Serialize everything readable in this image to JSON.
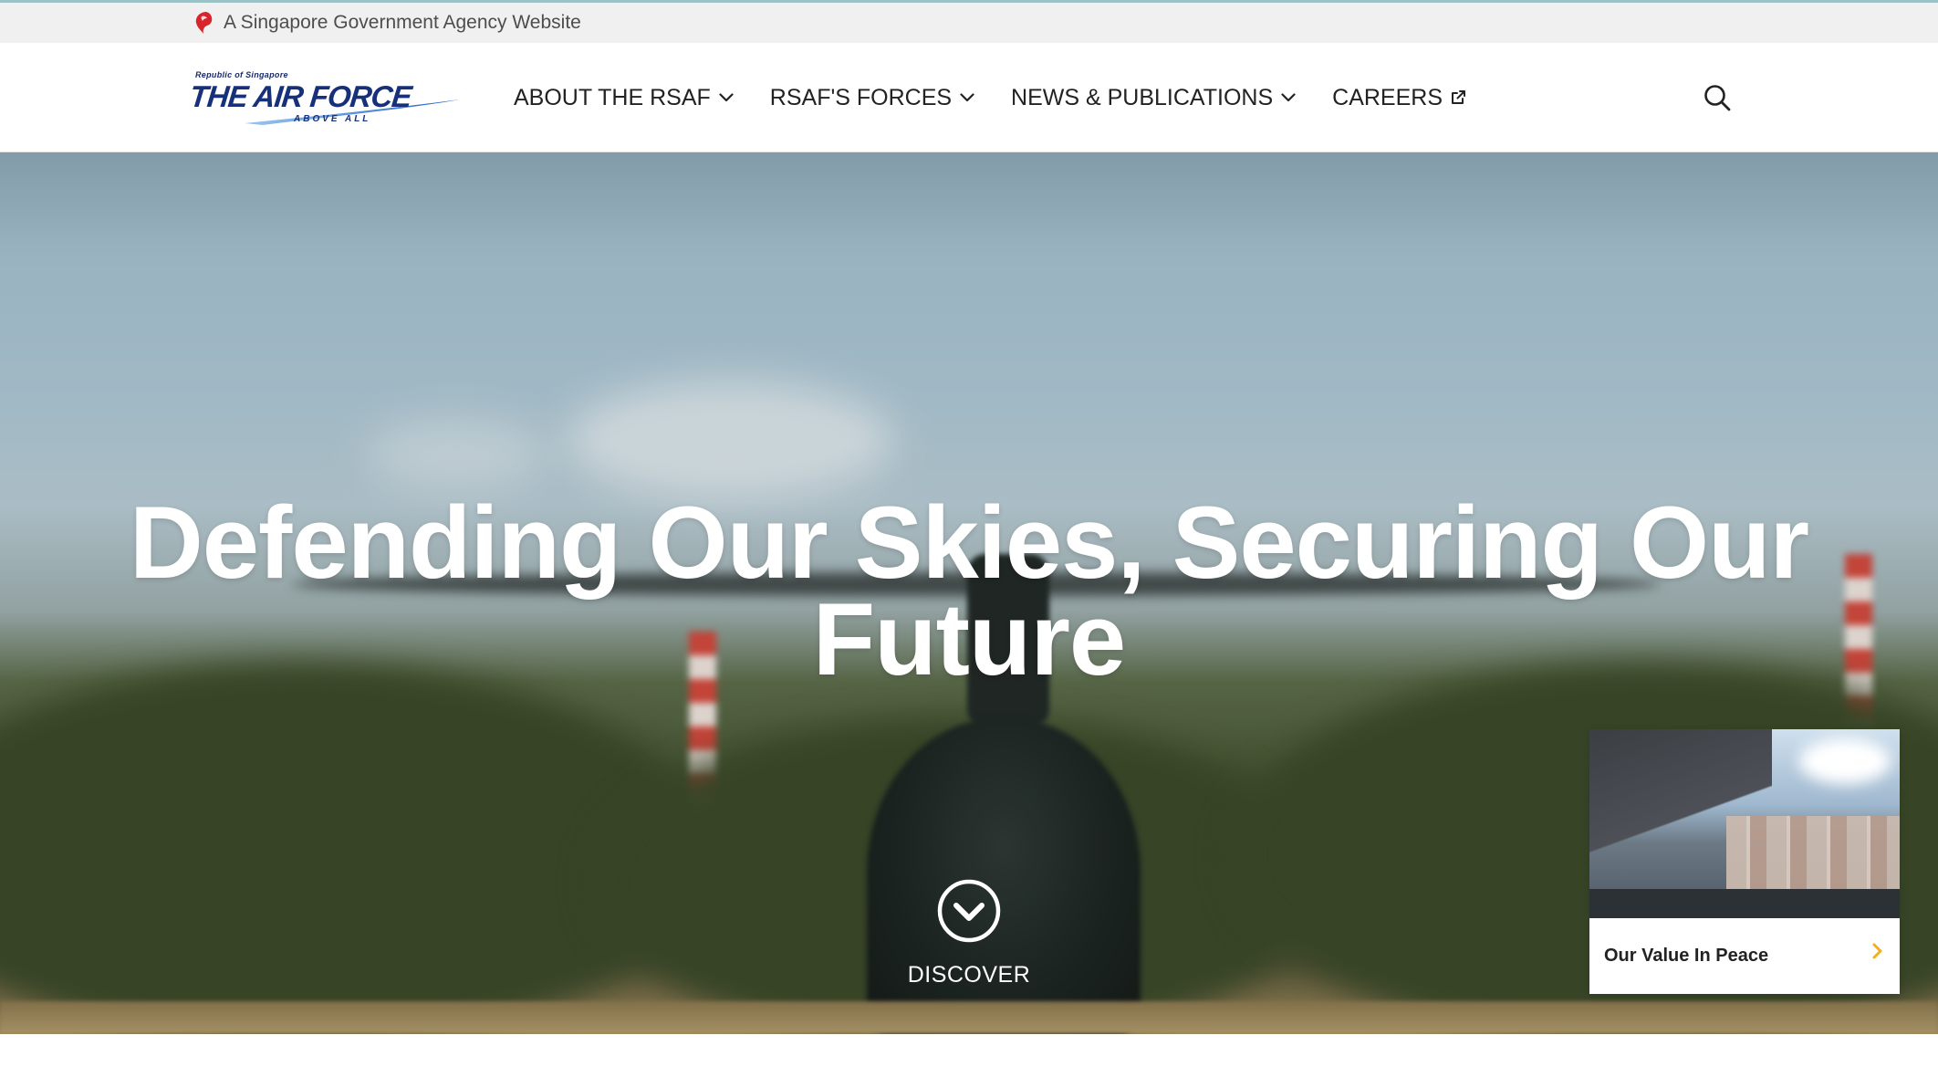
{
  "masthead": {
    "text": "A Singapore Government Agency Website",
    "icon": "singapore-lion-icon"
  },
  "logo": {
    "republic": "Republic of Singapore",
    "wordmark": "THE AIR FORCE",
    "tagline": "ABOVE ALL"
  },
  "nav": {
    "items": [
      {
        "label": "ABOUT THE RSAF",
        "icon": "chevron-down-icon"
      },
      {
        "label": "RSAF'S FORCES",
        "icon": "chevron-down-icon"
      },
      {
        "label": "NEWS & PUBLICATIONS",
        "icon": "chevron-down-icon"
      },
      {
        "label": "CAREERS",
        "icon": "external-link-icon"
      }
    ],
    "search_icon": "search-icon"
  },
  "hero": {
    "title": "Defending Our Skies, Securing Our Future",
    "discover_label": "DISCOVER",
    "discover_icon": "chevron-down-circle-icon"
  },
  "card": {
    "title": "Our Value In Peace",
    "arrow_icon": "chevron-right-icon"
  },
  "colors": {
    "masthead_bg": "#f0f0f0",
    "nav_text": "#222222",
    "logo_blue": "#17307a",
    "accent_yellow": "#f2b01e",
    "lion_red": "#d8242b"
  }
}
